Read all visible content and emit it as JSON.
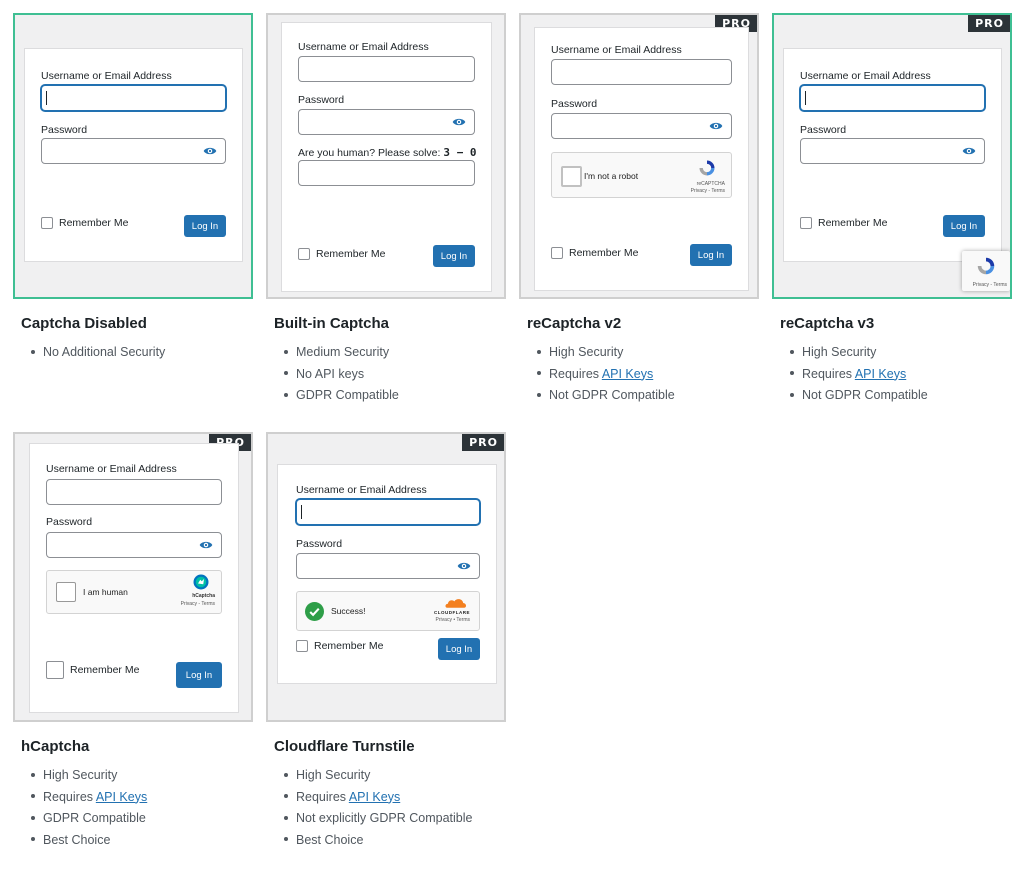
{
  "login": {
    "username_label": "Username or Email Address",
    "password_label": "Password",
    "remember_label": "Remember Me",
    "login_button": "Log In"
  },
  "pro_badge": "PRO",
  "builtin": {
    "question": "Are you human? Please solve:",
    "equation": "3 − 0"
  },
  "recaptcha_v2": {
    "checkbox_label": "I'm not a robot",
    "brand": "reCAPTCHA",
    "links": "Privacy - Terms"
  },
  "recaptcha_v3": {
    "badge_links": "Privacy - Terms"
  },
  "hcaptcha": {
    "checkbox_label": "I am human",
    "brand": "hCaptcha",
    "links": "Privacy - Terms"
  },
  "turnstile": {
    "status": "Success!",
    "brand": "CLOUDFLARE",
    "links": "Privacy • Terms"
  },
  "options": [
    {
      "title": "Captcha Disabled",
      "selected": true,
      "pro": false,
      "features": [
        {
          "text": "No Additional Security"
        }
      ]
    },
    {
      "title": "Built-in Captcha",
      "selected": false,
      "pro": false,
      "features": [
        {
          "text": "Medium Security"
        },
        {
          "text": "No API keys"
        },
        {
          "text": "GDPR Compatible"
        }
      ]
    },
    {
      "title": "reCaptcha v2",
      "selected": false,
      "pro": true,
      "features": [
        {
          "text": "High Security"
        },
        {
          "text": "Requires ",
          "link": "API Keys"
        },
        {
          "text": "Not GDPR Compatible"
        }
      ]
    },
    {
      "title": "reCaptcha v3",
      "selected": true,
      "pro": true,
      "features": [
        {
          "text": "High Security"
        },
        {
          "text": "Requires ",
          "link": "API Keys"
        },
        {
          "text": "Not GDPR Compatible"
        }
      ]
    },
    {
      "title": "hCaptcha",
      "selected": false,
      "pro": true,
      "features": [
        {
          "text": "High Security"
        },
        {
          "text": "Requires ",
          "link": "API Keys"
        },
        {
          "text": "GDPR Compatible"
        },
        {
          "text": "Best Choice"
        }
      ]
    },
    {
      "title": "Cloudflare Turnstile",
      "selected": false,
      "pro": true,
      "features": [
        {
          "text": "High Security"
        },
        {
          "text": "Requires ",
          "link": "API Keys"
        },
        {
          "text": "Not explicitly GDPR Compatible"
        },
        {
          "text": "Best Choice"
        }
      ]
    }
  ],
  "colors": {
    "accent": "#2271b1",
    "selected_border": "#3fbf93",
    "success": "#2e9e48",
    "cloudflare": "#f38020"
  }
}
